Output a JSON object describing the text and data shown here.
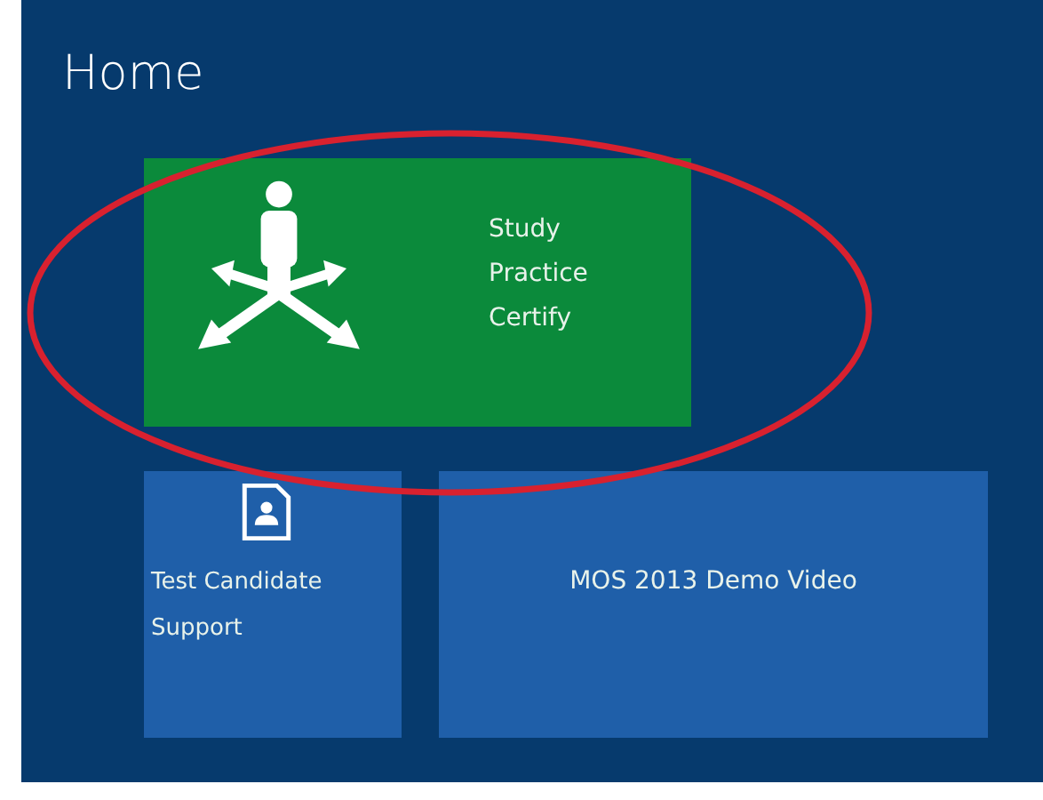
{
  "page": {
    "title": "Home"
  },
  "tiles": [
    {
      "kind": "hero",
      "color": "#0b8a3b",
      "lines": [
        "Study",
        "Practice",
        "Certify"
      ]
    },
    {
      "kind": "icon",
      "color": "#1f5fa9",
      "lines": [
        "Test Candidate",
        "Support"
      ]
    },
    {
      "kind": "text",
      "color": "#1f5fa9",
      "lines": [
        "MOS 2013 Demo Video"
      ]
    }
  ],
  "annotation": {
    "kind": "ellipse",
    "color": "#d8212f"
  }
}
